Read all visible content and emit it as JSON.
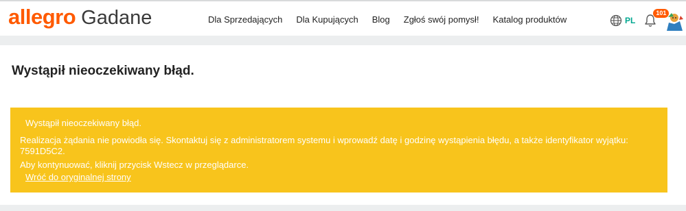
{
  "header": {
    "brand": "allegro",
    "subtitle": "Gadane",
    "nav": [
      {
        "label": "Dla Sprzedających"
      },
      {
        "label": "Dla Kupujących"
      },
      {
        "label": "Blog"
      },
      {
        "label": "Zgłoś swój pomysł!"
      },
      {
        "label": "Katalog produktów"
      }
    ],
    "language": "PL",
    "notification_count": "101",
    "colors": {
      "brand": "#ff5a00",
      "language": "#00a790",
      "alert": "#f8c41c"
    }
  },
  "main": {
    "title": "Wystąpił nieoczekiwany błąd.",
    "alert": {
      "heading": "Wystąpił nieoczekiwany błąd.",
      "message": "Realizacja żądania nie powiodła się. Skontaktuj się z administratorem systemu i wprowadź datę i godzinę wystąpienia błędu, a także identyfikator wyjątku: 7591D5C2.",
      "hint": "Aby kontynuować, kliknij przycisk Wstecz w przeglądarce.",
      "link_label": "Wróć do oryginalnej strony"
    }
  },
  "icons": {
    "globe": "globe-icon",
    "bell": "bell-icon",
    "avatar": "avatar"
  }
}
